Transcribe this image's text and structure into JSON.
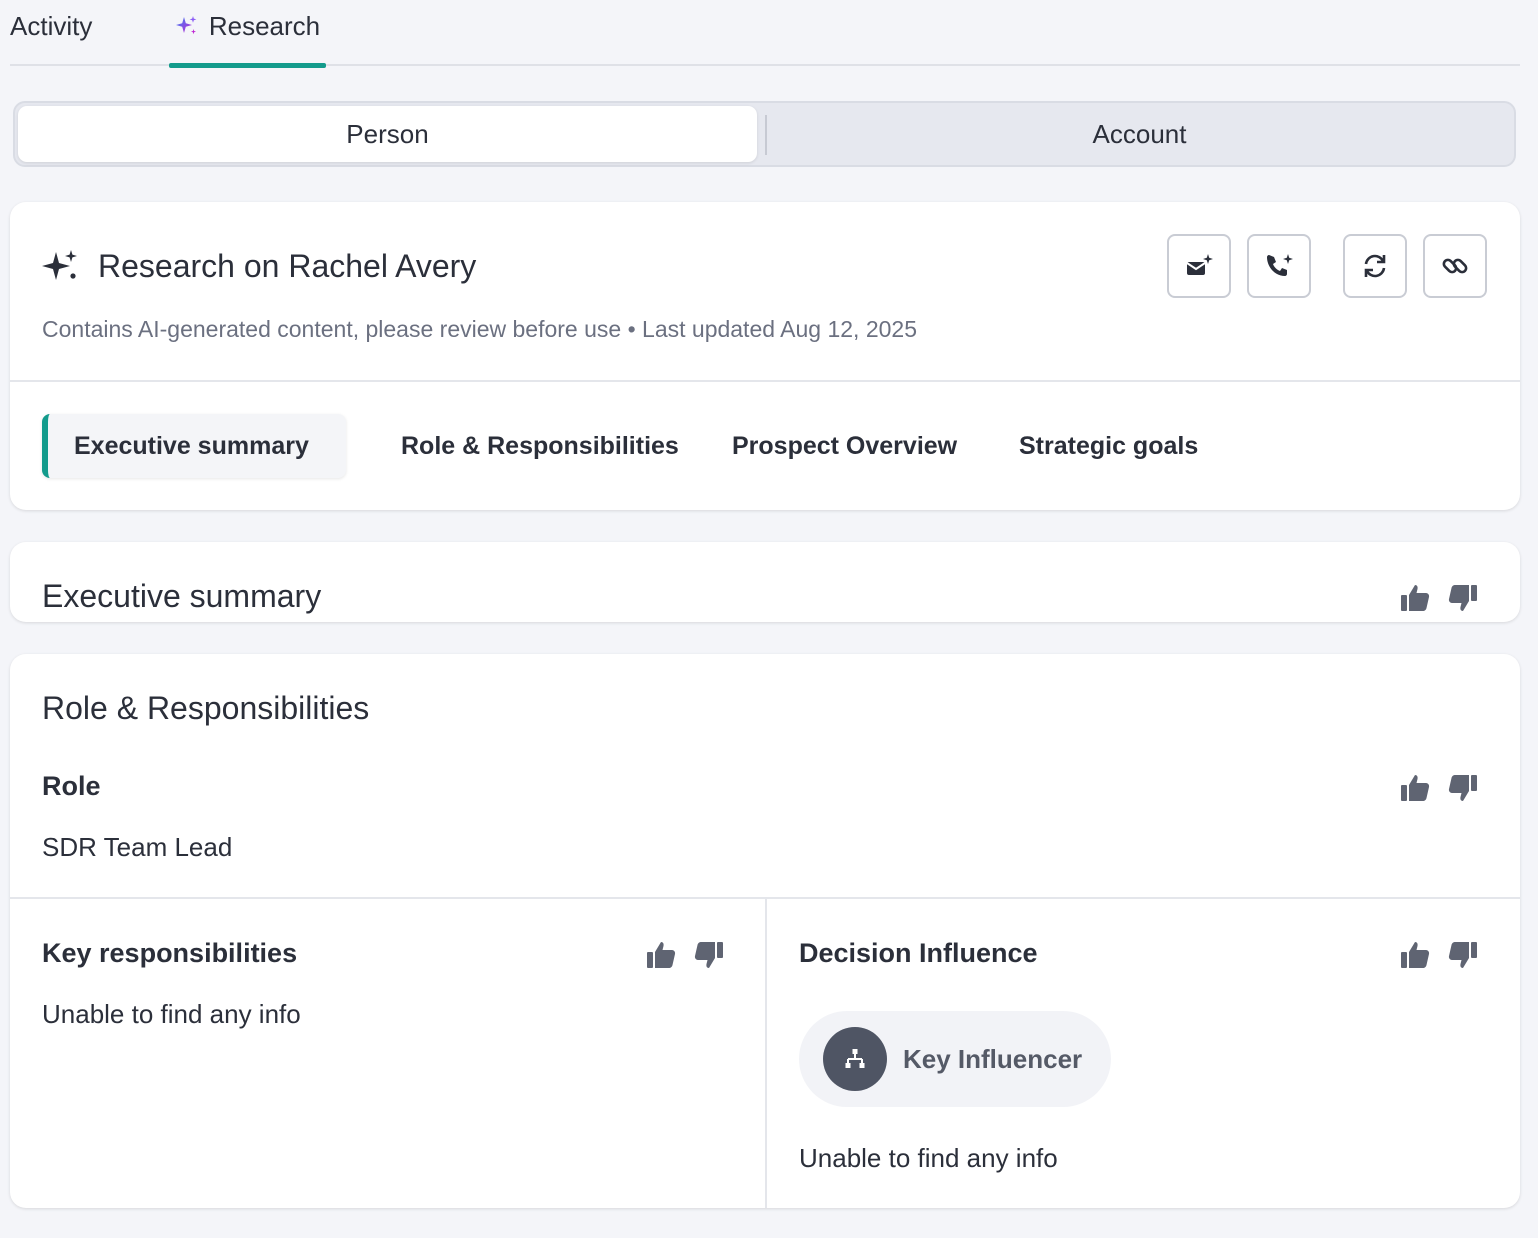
{
  "tabs": {
    "activity": "Activity",
    "research": "Research"
  },
  "segments": {
    "person": "Person",
    "account": "Account"
  },
  "header": {
    "title": "Research on Rachel Avery",
    "subtitle": "Contains AI-generated content, please review before use • Last updated Aug 12, 2025",
    "actions": [
      "mail-sparkle-icon",
      "phone-sparkle-icon",
      "refresh-icon",
      "link-icon"
    ]
  },
  "subtabs": [
    "Executive summary",
    "Role & Responsibilities",
    "Prospect Overview",
    "Strategic goals"
  ],
  "executive_summary": {
    "title": "Executive summary"
  },
  "role_section": {
    "title": "Role & Responsibilities",
    "role_label": "Role",
    "role_value": "SDR Team Lead",
    "key_resp_label": "Key responsibilities",
    "key_resp_value": "Unable to find any info",
    "decision_label": "Decision Influence",
    "influence_badge": "Key Influencer",
    "decision_value": "Unable to find any info"
  },
  "colors": {
    "accent": "#139b8c",
    "text": "#2b2f3a",
    "muted": "#6b7080",
    "icon": "#5f6472"
  }
}
